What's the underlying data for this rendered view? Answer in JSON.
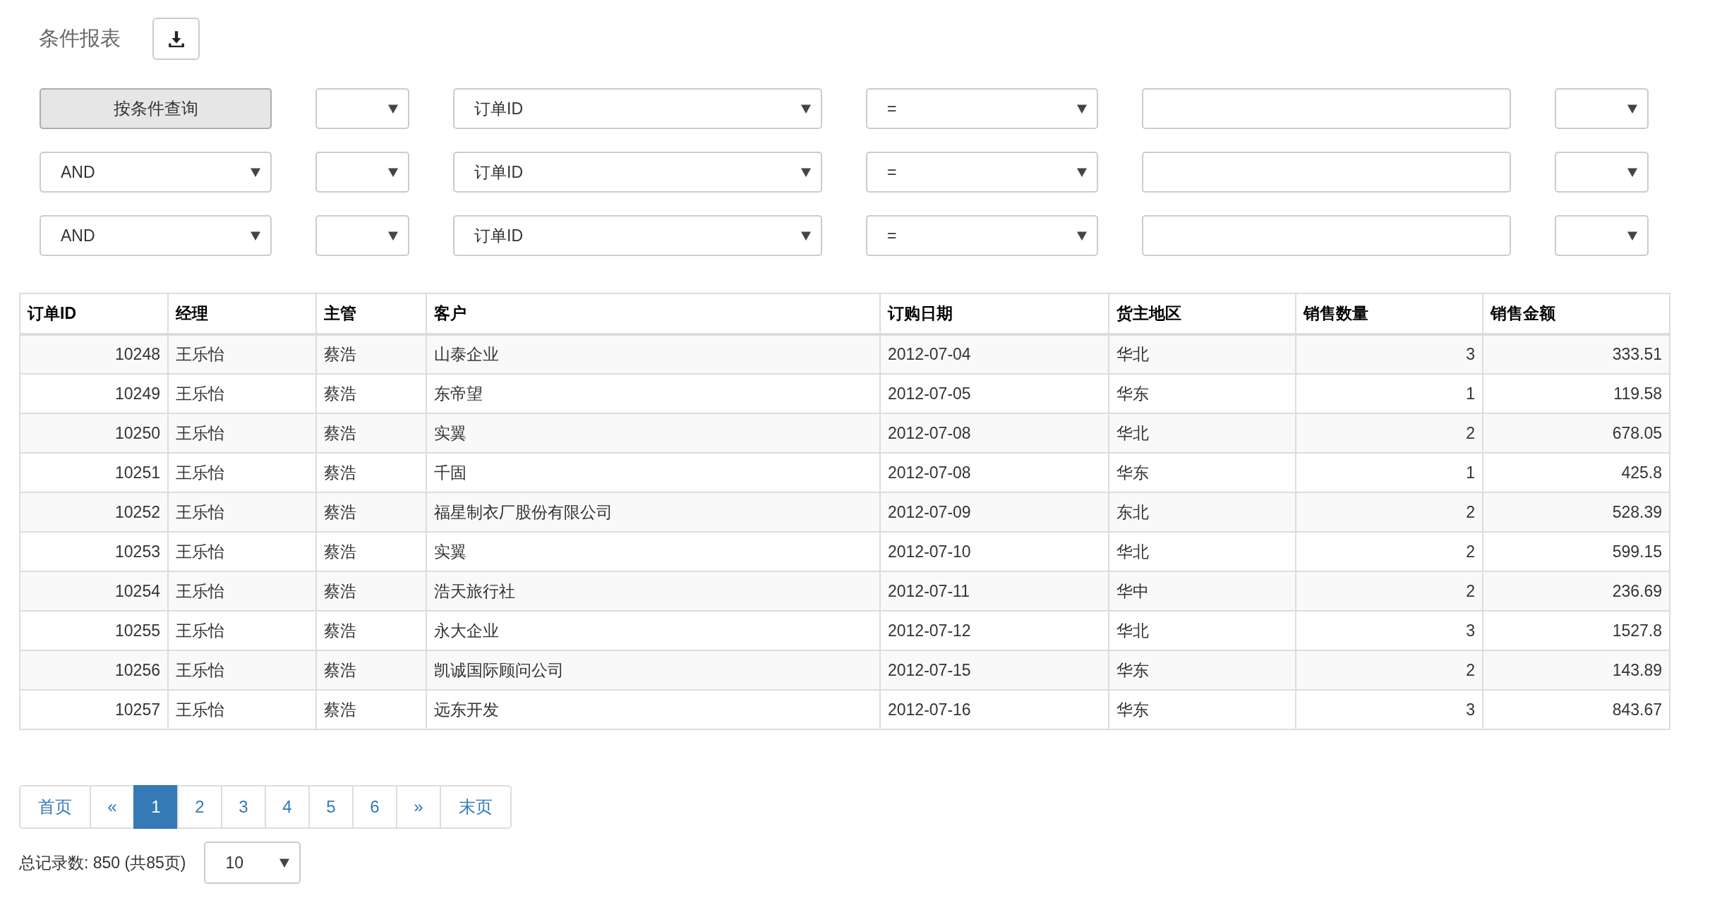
{
  "header": {
    "title": "条件报表"
  },
  "filters": [
    {
      "lead": {
        "kind": "button",
        "label": "按条件查询"
      },
      "field": "订单ID",
      "operator": "="
    },
    {
      "lead": {
        "kind": "select",
        "label": "AND"
      },
      "field": "订单ID",
      "operator": "="
    },
    {
      "lead": {
        "kind": "select",
        "label": "AND"
      },
      "field": "订单ID",
      "operator": "="
    }
  ],
  "table": {
    "columns": [
      {
        "label": "订单ID",
        "kind": "number"
      },
      {
        "label": "经理",
        "kind": "text"
      },
      {
        "label": "主管",
        "kind": "text"
      },
      {
        "label": "客户",
        "kind": "text"
      },
      {
        "label": "订购日期",
        "kind": "text"
      },
      {
        "label": "货主地区",
        "kind": "text"
      },
      {
        "label": "销售数量",
        "kind": "number"
      },
      {
        "label": "销售金额",
        "kind": "number"
      }
    ],
    "rows": [
      [
        "10248",
        "王乐怡",
        "蔡浩",
        "山泰企业",
        "2012-07-04",
        "华北",
        "3",
        "333.51"
      ],
      [
        "10249",
        "王乐怡",
        "蔡浩",
        "东帝望",
        "2012-07-05",
        "华东",
        "1",
        "119.58"
      ],
      [
        "10250",
        "王乐怡",
        "蔡浩",
        "实翼",
        "2012-07-08",
        "华北",
        "2",
        "678.05"
      ],
      [
        "10251",
        "王乐怡",
        "蔡浩",
        "千固",
        "2012-07-08",
        "华东",
        "1",
        "425.8"
      ],
      [
        "10252",
        "王乐怡",
        "蔡浩",
        "福星制衣厂股份有限公司",
        "2012-07-09",
        "东北",
        "2",
        "528.39"
      ],
      [
        "10253",
        "王乐怡",
        "蔡浩",
        "实翼",
        "2012-07-10",
        "华北",
        "2",
        "599.15"
      ],
      [
        "10254",
        "王乐怡",
        "蔡浩",
        "浩天旅行社",
        "2012-07-11",
        "华中",
        "2",
        "236.69"
      ],
      [
        "10255",
        "王乐怡",
        "蔡浩",
        "永大企业",
        "2012-07-12",
        "华北",
        "3",
        "1527.8"
      ],
      [
        "10256",
        "王乐怡",
        "蔡浩",
        "凯诚国际顾问公司",
        "2012-07-15",
        "华东",
        "2",
        "143.89"
      ],
      [
        "10257",
        "王乐怡",
        "蔡浩",
        "远东开发",
        "2012-07-16",
        "华东",
        "3",
        "843.67"
      ]
    ]
  },
  "pagination": {
    "items": [
      {
        "label": "首页",
        "selected": false
      },
      {
        "label": "«",
        "selected": false
      },
      {
        "label": "1",
        "selected": true
      },
      {
        "label": "2",
        "selected": false
      },
      {
        "label": "3",
        "selected": false
      },
      {
        "label": "4",
        "selected": false
      },
      {
        "label": "5",
        "selected": false
      },
      {
        "label": "6",
        "selected": false
      },
      {
        "label": "»",
        "selected": false
      },
      {
        "label": "末页",
        "selected": false
      }
    ]
  },
  "footer": {
    "total": "总记录数: 850 (共85页)",
    "page_size": "10"
  }
}
